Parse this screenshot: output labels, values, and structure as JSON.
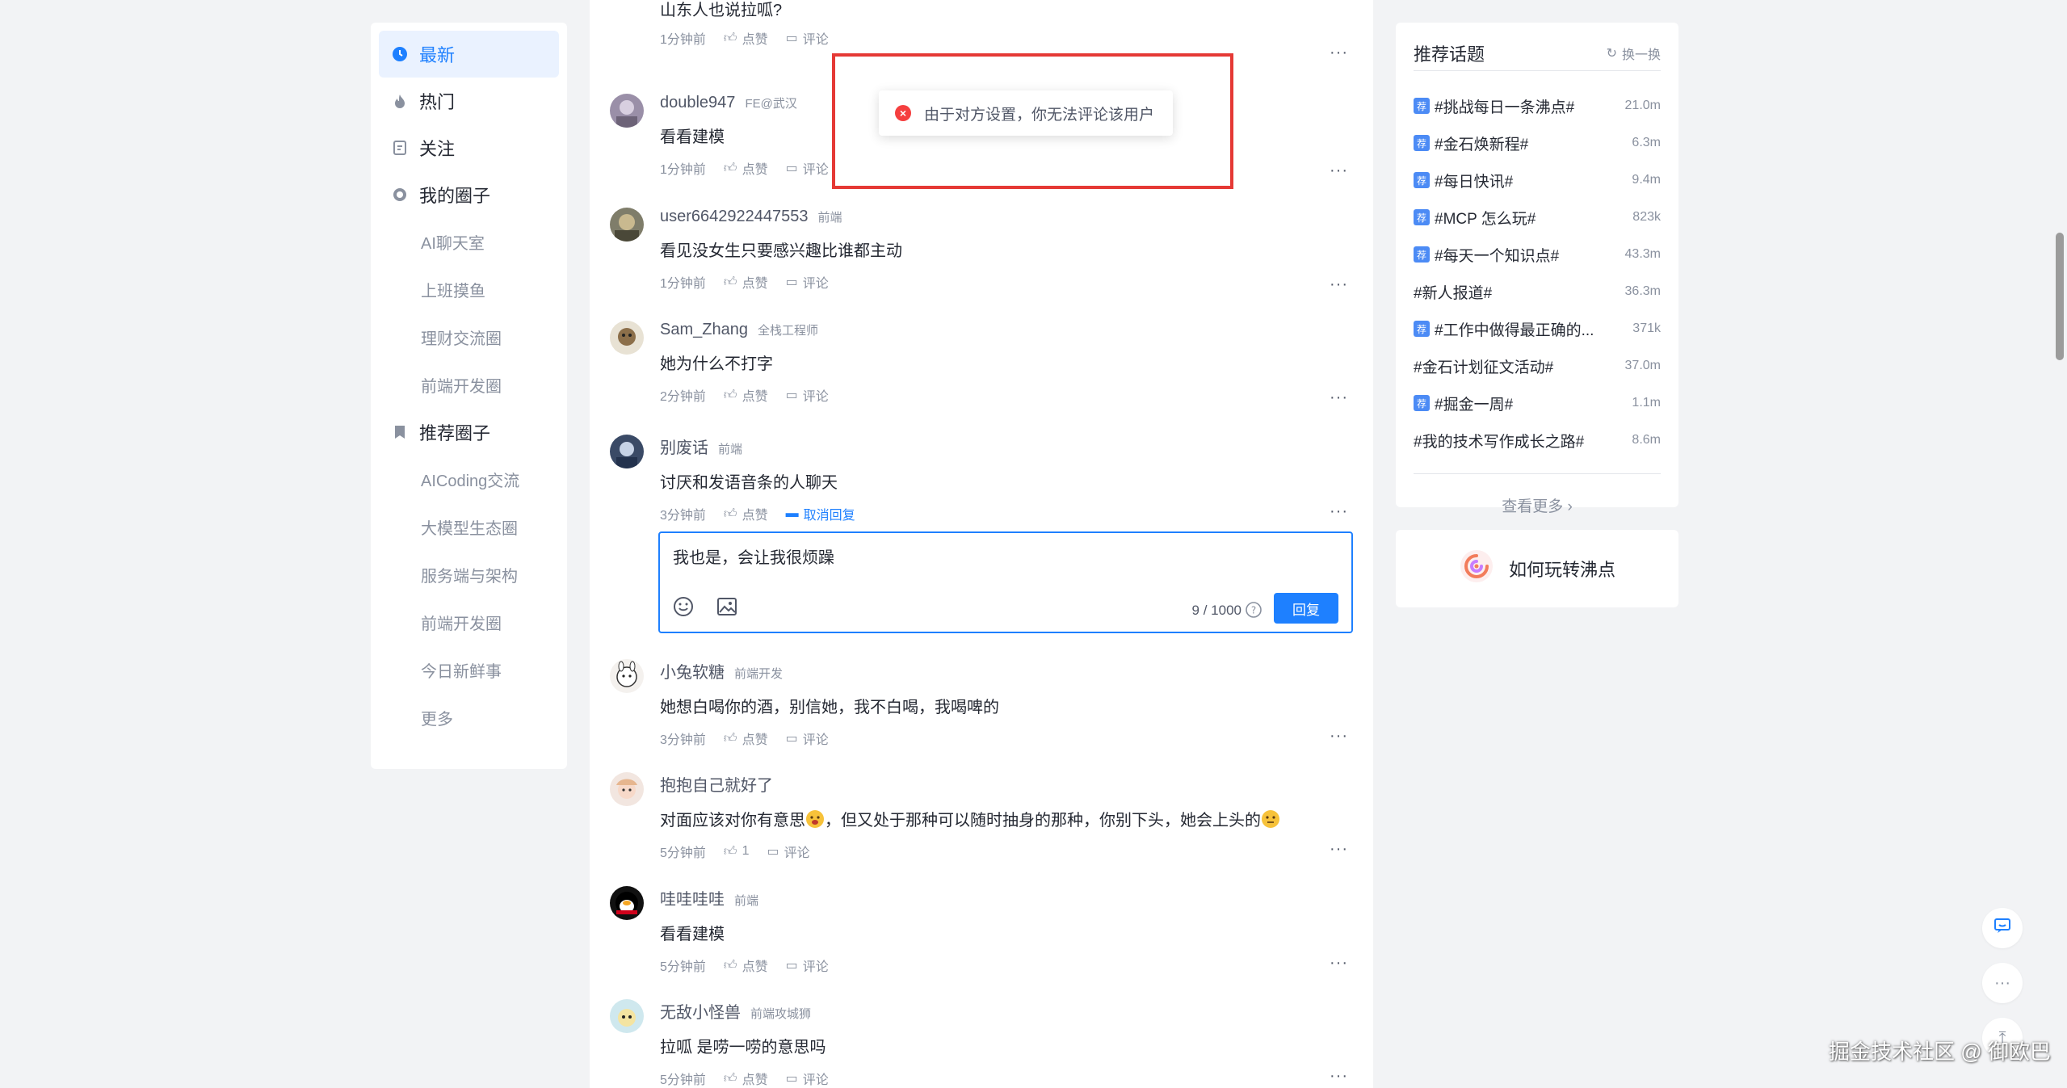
{
  "nav": {
    "items": [
      {
        "label": "最新",
        "icon": "clock-icon",
        "active": true
      },
      {
        "label": "热门",
        "icon": "flame-icon"
      },
      {
        "label": "关注",
        "icon": "follow-icon"
      },
      {
        "label": "我的圈子",
        "icon": "circle-icon"
      }
    ],
    "my_circles": [
      "AI聊天室",
      "上班摸鱼",
      "理财交流圈",
      "前端开发圈"
    ],
    "recommended_label": "推荐圈子",
    "recommended_circles": [
      "AICoding交流",
      "大模型生态圈",
      "服务端与架构",
      "前端开发圈",
      "今日新鲜事",
      "更多"
    ]
  },
  "comments": [
    {
      "text": "山东人也说拉呱?",
      "time": "1分钟前",
      "like": "点赞",
      "comment": "评论"
    },
    {
      "user": "double947",
      "tag": "FE@武汉",
      "text": "看看建模",
      "time": "1分钟前",
      "like": "点赞",
      "comment": "评论"
    },
    {
      "user": "user6642922447553",
      "tag": "前端",
      "text": "看见没女生只要感兴趣比谁都主动",
      "time": "1分钟前",
      "like": "点赞",
      "comment": "评论"
    },
    {
      "user": "Sam_Zhang",
      "tag": "全栈工程师",
      "text": "她为什么不打字",
      "time": "2分钟前",
      "like": "点赞",
      "comment": "评论"
    },
    {
      "user": "别废话",
      "tag": "前端",
      "text": "讨厌和发语音条的人聊天",
      "time": "3分钟前",
      "like": "点赞",
      "comment": "取消回复"
    },
    {
      "user": "小兔软糖",
      "tag": "前端开发",
      "text": "她想白喝你的酒，别信她，我不白喝，我喝啤的",
      "time": "3分钟前",
      "like": "点赞",
      "comment": "评论"
    },
    {
      "user": "抱抱自己就好了",
      "tag": "",
      "text_a": "对面应该对你有意思",
      "text_b": "，但又处于那种可以随时抽身的那种，你别下头，她会上头的",
      "time": "5分钟前",
      "like": "1",
      "comment": "评论"
    },
    {
      "user": "哇哇哇哇",
      "tag": "前端",
      "text": "看看建模",
      "time": "5分钟前",
      "like": "点赞",
      "comment": "评论"
    },
    {
      "user": "无敌小怪兽",
      "tag": "前端攻城狮",
      "text": "拉呱 是唠一唠的意思吗",
      "time": "5分钟前",
      "like": "点赞",
      "comment": "评论"
    }
  ],
  "reply": {
    "value": "我也是，会让我很烦躁",
    "count": "9 / 1000",
    "button": "回复"
  },
  "toast": {
    "message": "由于对方设置，你无法评论该用户"
  },
  "topics": {
    "title": "推荐话题",
    "refresh": "换一换",
    "items": [
      {
        "name": "#挑战每日一条沸点#",
        "count": "21.0m",
        "badge": true
      },
      {
        "name": "#金石焕新程#",
        "count": "6.3m",
        "badge": true
      },
      {
        "name": "#每日快讯#",
        "count": "9.4m",
        "badge": true
      },
      {
        "name": "#MCP 怎么玩#",
        "count": "823k",
        "badge": true
      },
      {
        "name": "#每天一个知识点#",
        "count": "43.3m",
        "badge": true
      },
      {
        "name": "#新人报道#",
        "count": "36.3m",
        "badge": false
      },
      {
        "name": "#工作中做得最正确的...",
        "count": "371k",
        "badge": true
      },
      {
        "name": "#金石计划征文活动#",
        "count": "37.0m",
        "badge": false
      },
      {
        "name": "#掘金一周#",
        "count": "1.1m",
        "badge": true
      },
      {
        "name": "#我的技术写作成长之路#",
        "count": "8.6m",
        "badge": false
      }
    ],
    "badge_text": "荐",
    "see_more": "查看更多"
  },
  "howto": {
    "label": "如何玩转沸点"
  },
  "watermark": "掘金技术社区 @ 御欧巴",
  "colors": {
    "accent": "#1e80ff",
    "error": "#f53f3f",
    "highlight_border": "#e53935"
  }
}
